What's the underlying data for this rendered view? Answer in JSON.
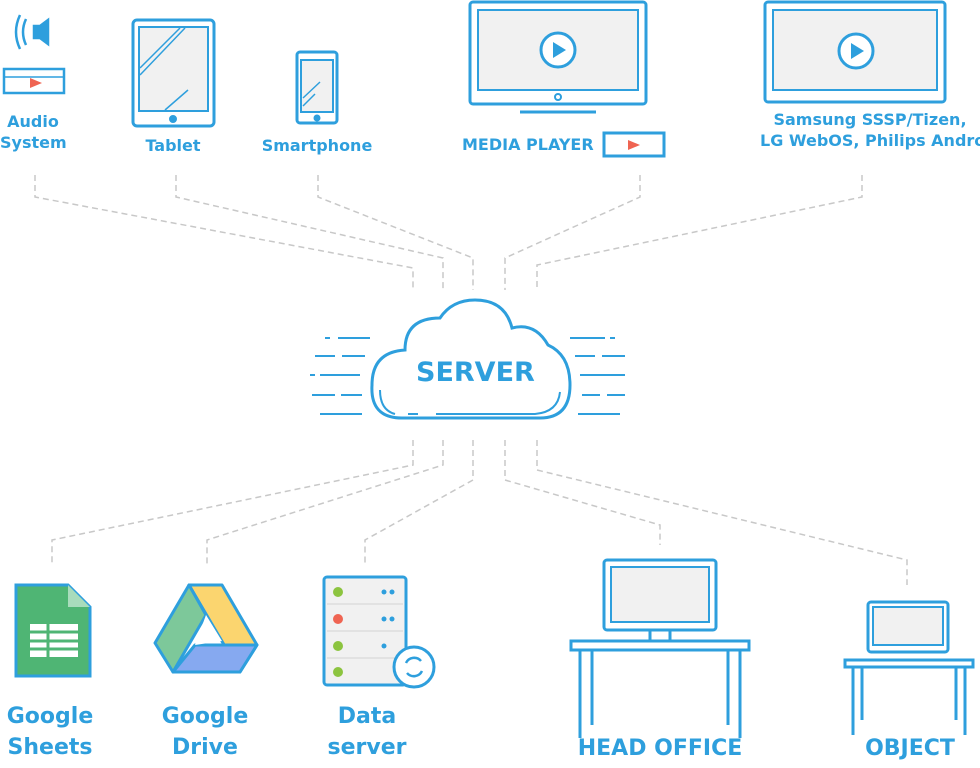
{
  "colors": {
    "primary": "#2e9fdd",
    "connector": "#c8c8c8",
    "play": "#ef6452",
    "sheets": "#4fb574",
    "status_green": "#8cc43f",
    "status_red": "#ef6452"
  },
  "server": {
    "label": "SERVER",
    "icon": "cloud-icon"
  },
  "clients": [
    {
      "label": "Audio System",
      "line1": "Audio",
      "line2": "System",
      "icon": "speaker-icon"
    },
    {
      "label": "Tablet",
      "icon": "tablet-icon"
    },
    {
      "label": "Smartphone",
      "icon": "smartphone-icon"
    },
    {
      "label": "MEDIA PLAYER",
      "icon": "monitor-icon"
    },
    {
      "label": "Samsung SSSP/Tizen, LG WebOS, Philips Android",
      "line1": "Samsung SSSP/Tizen,",
      "line2": "LG WebOS, Philips Android",
      "icon": "smart-tv-icon"
    }
  ],
  "sources": [
    {
      "line1": "Google",
      "line2": "Sheets",
      "icon": "google-sheets-icon"
    },
    {
      "line1": "Google",
      "line2": "Drive",
      "icon": "google-drive-icon"
    },
    {
      "line1": "Data",
      "line2": "server",
      "icon": "data-server-icon"
    },
    {
      "label": "HEAD OFFICE",
      "icon": "desktop-workstation-icon"
    },
    {
      "label": "OBJECT",
      "icon": "laptop-desk-icon"
    }
  ]
}
